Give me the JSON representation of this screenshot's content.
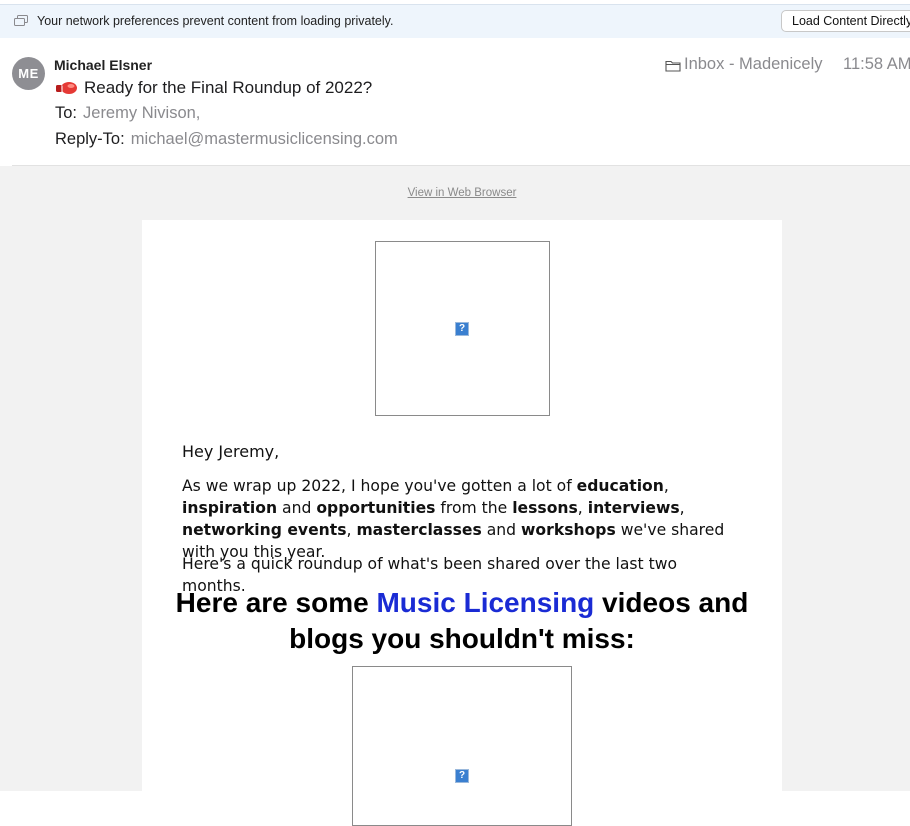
{
  "banner": {
    "message": "Your network preferences prevent content from loading privately.",
    "button_label": "Load Content Directly",
    "icon": "privacy-icon"
  },
  "message": {
    "avatar_initials": "ME",
    "sender": "Michael Elsner",
    "subject": "Ready for the Final Roundup of 2022?",
    "subject_icon": "boxing-glove-icon",
    "to_label": "To:",
    "to_value": "Jeremy Nivison,",
    "reply_to_label": "Reply-To:",
    "reply_to_value": "michael@mastermusiclicensing.com",
    "mailbox": "Inbox - Madenicely",
    "time": "11:58 AM"
  },
  "email": {
    "web_link": "View in Web Browser",
    "greeting": "Hey Jeremy,",
    "wrap_up": {
      "t1": "As we wrap up 2022, I hope you've gotten a lot of ",
      "b1": "education",
      "t2": ", ",
      "b2": "inspiration",
      "t3": " and ",
      "b3": "opportunities",
      "t4": " from the ",
      "b4": "lessons",
      "t5": ", ",
      "b5": "interviews",
      "t6": ", ",
      "b6": "networking events",
      "t7": ", ",
      "b7": "masterclasses",
      "t8": " and ",
      "b8": "workshops",
      "t9": " we've shared with you this year."
    },
    "roundup": "Here's a quick roundup of what's been shared over the last two months.",
    "headline": {
      "pre": "Here are some ",
      "accent": "Music Licensing",
      "post": " videos and blogs you shouldn't miss:"
    },
    "image_placeholder_glyph": "?"
  },
  "colors": {
    "accent_blue": "#1a2bd4",
    "banner_bg": "#eef5fc",
    "body_bg": "#f2f2f2",
    "avatar_bg": "#8e8e93",
    "meta_gray": "#8a8a8e"
  }
}
